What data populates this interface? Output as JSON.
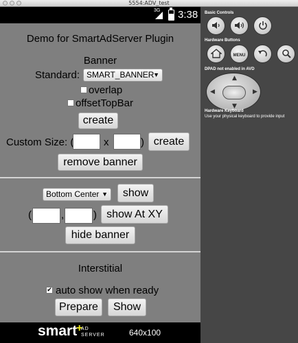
{
  "window": {
    "title": "5554:ADV_test"
  },
  "status_bar": {
    "network": "3G",
    "time": "3:38"
  },
  "app": {
    "title": "Demo for SmartAdServer Plugin",
    "banner": {
      "heading": "Banner",
      "standard_label": "Standard:",
      "standard_value": "SMART_BANNER",
      "overlap_label": "overlap",
      "overlap_checked": false,
      "offset_label": "offsetTopBar",
      "offset_checked": false,
      "create_label": "create",
      "custom_size_label": "Custom Size: (",
      "x_sep": "x",
      "close_paren": ")",
      "custom_create_label": "create",
      "remove_label": "remove banner"
    },
    "position": {
      "select_value": "Bottom Center",
      "show_label": "show",
      "open_paren": "(",
      "comma": ",",
      "close_paren": ")",
      "show_xy_label": "show At XY",
      "hide_label": "hide banner"
    },
    "interstitial": {
      "heading": "Interstitial",
      "auto_show_label": "auto show when ready",
      "auto_show_checked": true,
      "prepare_label": "Prepare",
      "show_label": "Show"
    }
  },
  "ad_banner": {
    "brand": "smart",
    "brand_mark": "+",
    "sub_line1": "AD",
    "sub_line2": "SERVER",
    "size": "640x100"
  },
  "emulator": {
    "basic_controls": "Basic Controls",
    "hardware_buttons": "Hardware Buttons",
    "menu_label": "MENU",
    "dpad_note": "DPAD not enabled in AVD",
    "keyboard_title": "Hardware Keyboard",
    "keyboard_note": "Use your physical keyboard to provide input"
  }
}
